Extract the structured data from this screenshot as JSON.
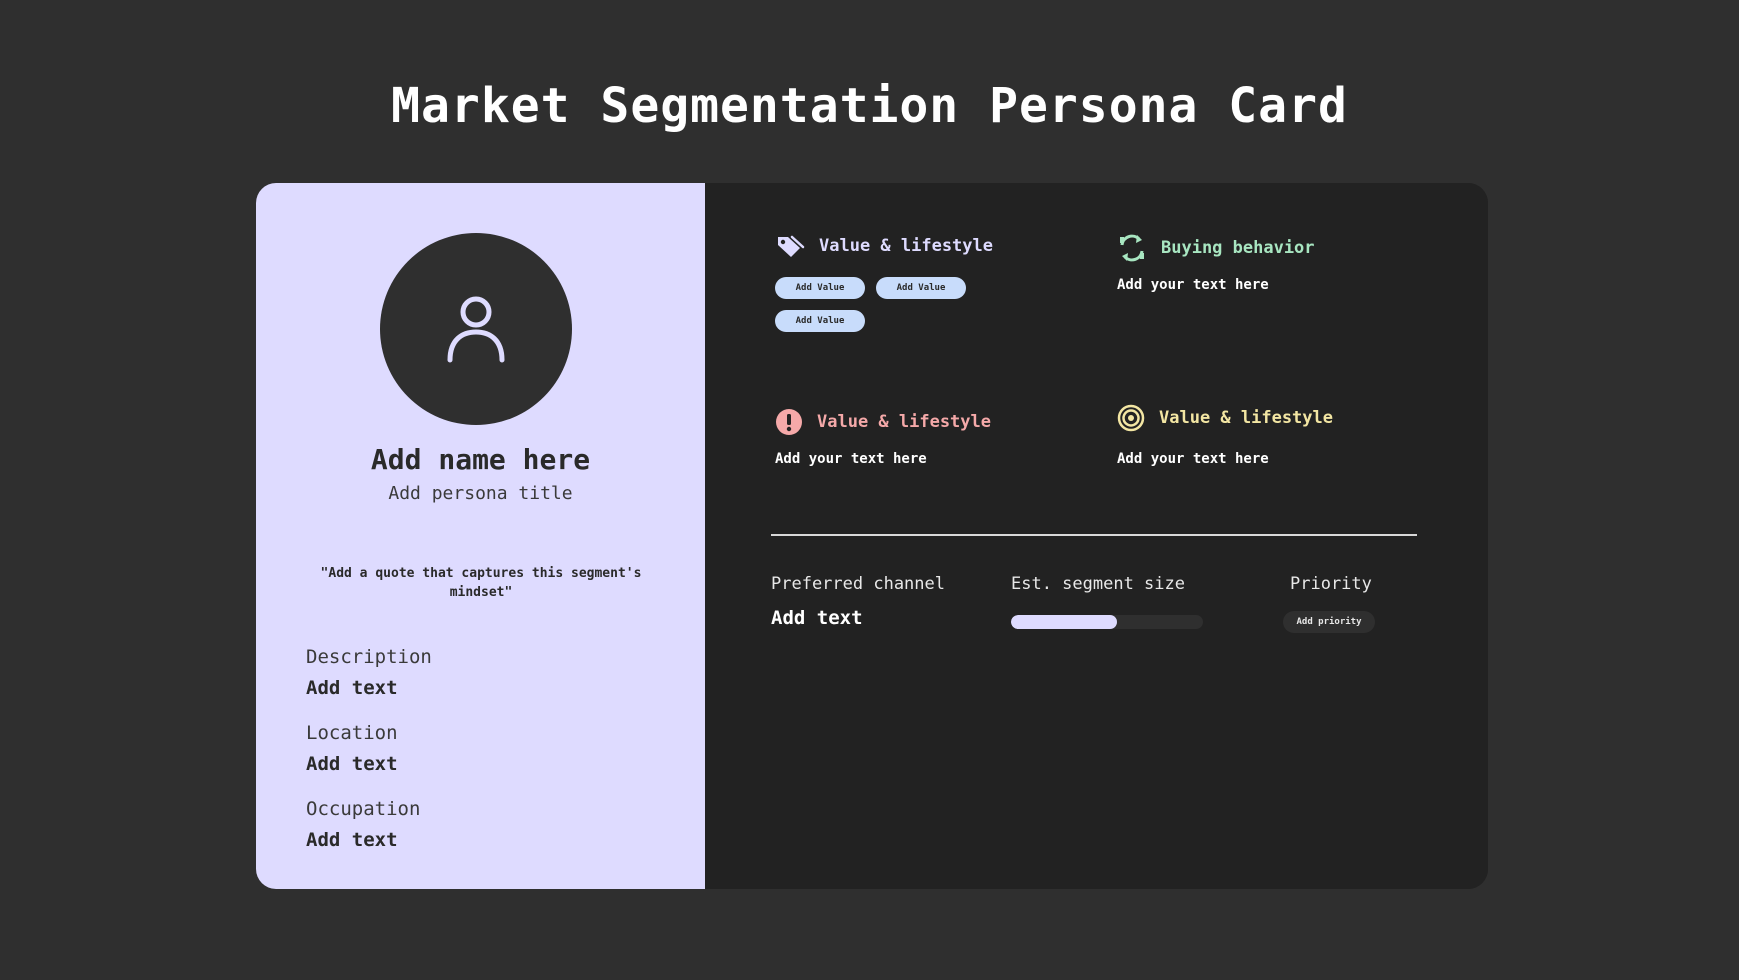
{
  "page": {
    "title": "Market Segmentation Persona Card"
  },
  "persona": {
    "avatar_icon": "user-icon",
    "name": "Add name here",
    "title": "Add persona title",
    "quote": "\"Add a quote that captures this segment's mindset\"",
    "fields": [
      {
        "label": "Description",
        "value": "Add text"
      },
      {
        "label": "Location",
        "value": "Add text"
      },
      {
        "label": "Occupation",
        "value": "Add text"
      }
    ]
  },
  "sections": {
    "values": {
      "icon": "tag-icon",
      "heading": "Value & lifestyle",
      "color": "#dedbff",
      "chips": [
        "Add Value",
        "Add Value",
        "Add Value"
      ]
    },
    "buying": {
      "icon": "refresh-icon",
      "heading": "Buying behavior",
      "color": "#a8e6c1",
      "text": "Add your text here"
    },
    "pain": {
      "icon": "alert-icon",
      "heading": "Value & lifestyle",
      "color": "#f5a9a9",
      "text": "Add your text here"
    },
    "goals": {
      "icon": "target-icon",
      "heading": "Value & lifestyle",
      "color": "#f3e6a3",
      "text": "Add your text here"
    }
  },
  "stats": {
    "channel_label": "Preferred channel",
    "channel_value": "Add text",
    "size_label": "Est. segment size",
    "size_progress": 0.55,
    "priority_label": "Priority",
    "priority_value": "Add priority"
  },
  "colors": {
    "background": "#2f2f2f",
    "card_dark": "#222222",
    "card_light": "#dedbff",
    "chip": "#c8dcfb"
  }
}
